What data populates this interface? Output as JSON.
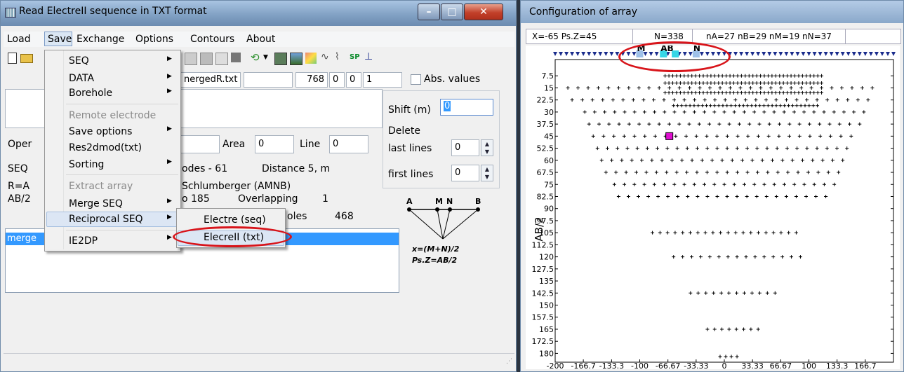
{
  "left_window": {
    "title": "Read ElectreII sequence in TXT format",
    "menu": [
      "Load",
      "Save",
      "Exchange",
      "Options",
      "Contours",
      "About"
    ],
    "toolbar_icons": [
      "new-file-icon",
      "open-folder-icon",
      "refresh-icon",
      "dropdown-icon",
      "grid-icon",
      "image-icon",
      "chart-icon",
      "wave-icon",
      "graph-icon",
      "sp-label-icon",
      "pin-icon"
    ],
    "toolbar_sp_label": "SP",
    "file_field": "nergedR.txt",
    "num_fields": [
      "768",
      "0",
      "0",
      "1"
    ],
    "abs_values_label": "Abs. values",
    "area_label": "Area",
    "area_value": "0",
    "line_label": "Line",
    "line_value": "0",
    "oper_label": "Oper",
    "seq_label": "SEQ",
    "electrodes_text": "odes -  61",
    "distance_text": "Distance  5, m",
    "r_label": "R=A",
    "array_text": "Schlumberger (AMNB)",
    "ab2_label": "AB/2",
    "p185_text": "o 185",
    "overlapping_label": "Overlapping",
    "overlapping_value": "1",
    "poles_text": "oles",
    "poles_value": "468",
    "shift_label": "Shift (m)",
    "shift_value": "0",
    "delete_label": "Delete",
    "last_lines_label": "last lines",
    "last_lines_value": "0",
    "first_lines_label": "first lines",
    "first_lines_value": "0",
    "list_selected": "merge",
    "diagram": {
      "a": "A",
      "m": "M",
      "n": "N",
      "b": "B",
      "formula1": "x=(M+N)/2",
      "formula2": "Ps.Z=AB/2"
    }
  },
  "save_menu": {
    "items": [
      {
        "label": "SEQ",
        "submenu": true,
        "disabled": false
      },
      {
        "label": "DATA",
        "submenu": true,
        "disabled": false
      },
      {
        "label": "Borehole",
        "submenu": true,
        "disabled": false
      },
      {
        "label": "Remote electrode",
        "submenu": false,
        "disabled": true
      },
      {
        "label": "Save options",
        "submenu": true,
        "disabled": false
      },
      {
        "label": "Res2dmod(txt)",
        "submenu": false,
        "disabled": false
      },
      {
        "label": "Sorting",
        "submenu": true,
        "disabled": false
      },
      {
        "label": "Extract array",
        "submenu": false,
        "disabled": true
      },
      {
        "label": "Merge SEQ",
        "submenu": true,
        "disabled": false
      },
      {
        "label": "Reciprocal SEQ",
        "submenu": true,
        "disabled": false
      },
      {
        "label": "IE2DP",
        "submenu": true,
        "disabled": false
      }
    ],
    "submenu_items": [
      "Electre (seq)",
      "ElecreII (txt)"
    ]
  },
  "right_window": {
    "title": "Configuration of array",
    "info_fields": [
      "X=-65 Ps.Z=45",
      "N=338",
      "nA=27 nB=29 nM=19 nN=37"
    ],
    "electrode_labels": {
      "m": "M",
      "ab": "AB",
      "n": "N"
    },
    "colors": {
      "marker": "#1a2c8c",
      "highlight": "#e010d0",
      "electrode_hl": "#36d6e6",
      "electrode_light": "#9ec0e8"
    }
  },
  "chart_data": {
    "type": "scatter",
    "ylabel": "AB/2",
    "xlim": [
      -200,
      200
    ],
    "ylim": [
      185,
      0
    ],
    "x_ticks": [
      "-200",
      "-166.7",
      "-133.3",
      "-100",
      "-66.67",
      "-33.33",
      "0",
      "33.33",
      "66.67",
      "100",
      "133.3",
      "166.7"
    ],
    "y_ticks": [
      "7.5",
      "15",
      "22.5",
      "30",
      "37.5",
      "45",
      "52.5",
      "60",
      "67.5",
      "75",
      "82.5",
      "90",
      "97.5",
      "105",
      "112.5",
      "120",
      "127.5",
      "135",
      "142.5",
      "150",
      "157.5",
      "165",
      "172.5",
      "180"
    ],
    "rows": [
      {
        "y": 7.5,
        "x_from": -70,
        "x_to": 115,
        "n": 42
      },
      {
        "y": 12,
        "x_from": -70,
        "x_to": 115,
        "n": 42
      },
      {
        "y": 15,
        "x_from": -185,
        "x_to": 175,
        "n": 31
      },
      {
        "y": 18,
        "x_from": -70,
        "x_to": 115,
        "n": 42
      },
      {
        "y": 22.5,
        "x_from": -180,
        "x_to": 170,
        "n": 30
      },
      {
        "y": 26,
        "x_from": -60,
        "x_to": 110,
        "n": 36
      },
      {
        "y": 30,
        "x_from": -165,
        "x_to": 165,
        "n": 29
      },
      {
        "y": 37.5,
        "x_from": -160,
        "x_to": 160,
        "n": 28
      },
      {
        "y": 45,
        "x_from": -155,
        "x_to": 150,
        "n": 26
      },
      {
        "y": 52.5,
        "x_from": -150,
        "x_to": 145,
        "n": 26
      },
      {
        "y": 60,
        "x_from": -145,
        "x_to": 140,
        "n": 25
      },
      {
        "y": 67.5,
        "x_from": -140,
        "x_to": 135,
        "n": 24
      },
      {
        "y": 75,
        "x_from": -130,
        "x_to": 130,
        "n": 23
      },
      {
        "y": 82.5,
        "x_from": -125,
        "x_to": 120,
        "n": 22
      },
      {
        "y": 105,
        "x_from": -85,
        "x_to": 85,
        "n": 20
      },
      {
        "y": 120,
        "x_from": -60,
        "x_to": 90,
        "n": 15
      },
      {
        "y": 142.5,
        "x_from": -40,
        "x_to": 60,
        "n": 12
      },
      {
        "y": 165,
        "x_from": -20,
        "x_to": 40,
        "n": 8
      },
      {
        "y": 182,
        "x_from": -5,
        "x_to": 15,
        "n": 4
      }
    ],
    "highlight_point": {
      "x": -65,
      "y": 45
    },
    "electrodes": {
      "x_from": -200,
      "x_to": 200,
      "n": 61
    }
  }
}
